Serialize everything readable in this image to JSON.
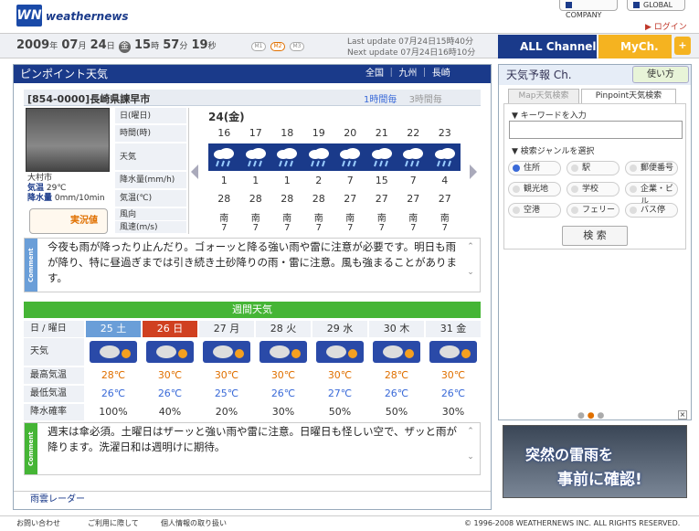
{
  "brand": {
    "logo": "WN",
    "name": "weathernews"
  },
  "top_links": {
    "company": "COMPANY",
    "global": "GLOBAL",
    "login": "ログイン"
  },
  "clock": {
    "year": "2009",
    "month": "07",
    "day": "24",
    "weekday": "金",
    "hour": "15",
    "minute": "57",
    "second": "19"
  },
  "modes": [
    "M1",
    "M2",
    "M3"
  ],
  "updates": {
    "last": "Last update 07月24日15時40分",
    "next": "Next update 07月24日16時10分"
  },
  "channels": {
    "all": "ALL Channel",
    "mych": "MyCh."
  },
  "main": {
    "title": "ピンポイント天気",
    "breadcrumb": [
      "全国",
      "九州",
      "長崎"
    ],
    "location": "[854-0000]長崎県諫早市",
    "toggle": [
      "1時間毎",
      "3時間毎"
    ],
    "station": {
      "name": "大村市",
      "temp_label": "気温",
      "temp": "29℃",
      "rain_label": "降水量",
      "rain": "0mm/10min"
    },
    "live_label": "実況値",
    "row_labels": [
      "日(曜日)",
      "時間(時)",
      "天気",
      "降水量(mm/h)",
      "気温(℃)",
      "風向",
      "風速(m/s)"
    ],
    "date": "24(金)",
    "hours": [
      "16",
      "17",
      "18",
      "19",
      "20",
      "21",
      "22",
      "23"
    ],
    "precip": [
      "1",
      "1",
      "1",
      "2",
      "7",
      "15",
      "7",
      "4"
    ],
    "temps": [
      "28",
      "28",
      "28",
      "28",
      "27",
      "27",
      "27",
      "27"
    ],
    "wind_dir": [
      "南",
      "南",
      "南",
      "南",
      "南",
      "南",
      "南",
      "南"
    ],
    "wind_speed": [
      "7",
      "7",
      "7",
      "7",
      "7",
      "7",
      "7",
      "7"
    ],
    "comment_tab": "Comment",
    "comment": "今夜も雨が降ったり止んだり。ゴォーッと降る強い雨や雷に注意が必要です。明日も雨が降り、特に昼過ぎまでは引き続き土砂降りの雨・雷に注意。風も強まることがあります。"
  },
  "weekly": {
    "title": "週間天気",
    "labels": [
      "日 / 曜日",
      "天気",
      "最高気温",
      "最低気温",
      "降水確率"
    ],
    "days": [
      "25 土",
      "26 日",
      "27 月",
      "28 火",
      "29 水",
      "30 木",
      "31 金"
    ],
    "highs": [
      "28℃",
      "30℃",
      "30℃",
      "30℃",
      "30℃",
      "28℃",
      "30℃"
    ],
    "lows": [
      "26℃",
      "26℃",
      "25℃",
      "26℃",
      "27℃",
      "26℃",
      "26℃"
    ],
    "pop": [
      "100%",
      "40%",
      "20%",
      "30%",
      "50%",
      "50%",
      "30%"
    ],
    "comment": "週末は傘必須。土曜日はザーッと強い雨や雷に注意。日曜日も怪しい空で、ザッと雨が降ります。洗濯日和は週明けに期待。"
  },
  "rain_radar": "雨雲レーダー",
  "footer": {
    "contact": "お問い合わせ",
    "terms": "ご利用に際して",
    "privacy": "個人情報の取り扱い",
    "copyright": "© 1996-2008 WEATHERNEWS INC. ALL RIGHTS RESERVED."
  },
  "right": {
    "title": "天気予報 Ch.",
    "howto": "使い方",
    "tabs": [
      "Map天気検索",
      "Pinpoint天気検索"
    ],
    "keyword_label": "キーワードを入力",
    "keyword_value": "",
    "genre_label": "検索ジャンルを選択",
    "genres": [
      "住所",
      "駅",
      "郵便番号",
      "観光地",
      "学校",
      "企業・ビル",
      "空港",
      "フェリー",
      "バス停"
    ],
    "search": "検 索",
    "banner": {
      "line1": "突然の雷雨を",
      "line2": "事前に確認!"
    }
  },
  "colors": {
    "navy": "#1a3a8a",
    "green": "#45b535",
    "orange": "#e07000",
    "sat": "#6a9ed8",
    "sun": "#d04020"
  }
}
